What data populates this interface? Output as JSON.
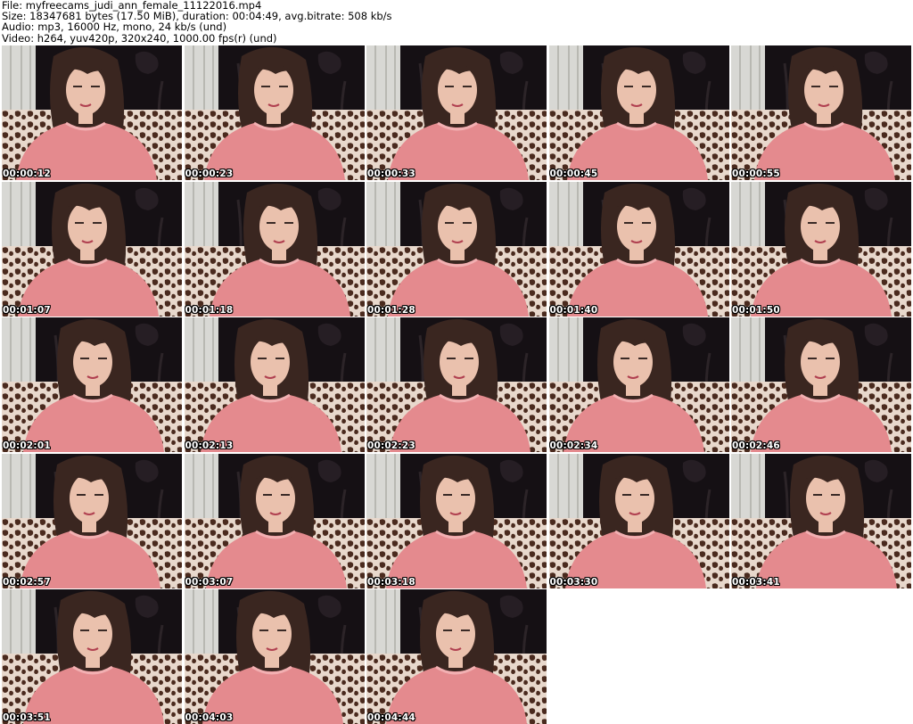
{
  "header": {
    "file_line": "File: myfreecams_judi_ann_female_11122016.mp4",
    "size_line": "Size: 18347681 bytes (17.50 MiB), duration: 00:04:49, avg.bitrate: 508 kb/s",
    "audio_line": "Audio: mp3, 16000 Hz, mono, 24 kb/s (und)",
    "video_line": "Video: h264, yuv420p, 320x240, 1000.00 fps(r) (und)"
  },
  "colors": {
    "background": "#ffffff",
    "curtain": "#d8d8d4",
    "wall": "#151014",
    "sweater": "#e48a8e",
    "hair": "#3a2620",
    "skin": "#eac1ad",
    "sofa_light": "#e8d8cc",
    "sofa_dark": "#4a2a1e"
  },
  "thumbnails": [
    {
      "timestamp": "00:00:12"
    },
    {
      "timestamp": "00:00:23"
    },
    {
      "timestamp": "00:00:33"
    },
    {
      "timestamp": "00:00:45"
    },
    {
      "timestamp": "00:00:55"
    },
    {
      "timestamp": "00:01:07"
    },
    {
      "timestamp": "00:01:18"
    },
    {
      "timestamp": "00:01:28"
    },
    {
      "timestamp": "00:01:40"
    },
    {
      "timestamp": "00:01:50"
    },
    {
      "timestamp": "00:02:01"
    },
    {
      "timestamp": "00:02:13"
    },
    {
      "timestamp": "00:02:23"
    },
    {
      "timestamp": "00:02:34"
    },
    {
      "timestamp": "00:02:46"
    },
    {
      "timestamp": "00:02:57"
    },
    {
      "timestamp": "00:03:07"
    },
    {
      "timestamp": "00:03:18"
    },
    {
      "timestamp": "00:03:30"
    },
    {
      "timestamp": "00:03:41"
    },
    {
      "timestamp": "00:03:51"
    },
    {
      "timestamp": "00:04:03"
    },
    {
      "timestamp": "00:04:44"
    }
  ]
}
